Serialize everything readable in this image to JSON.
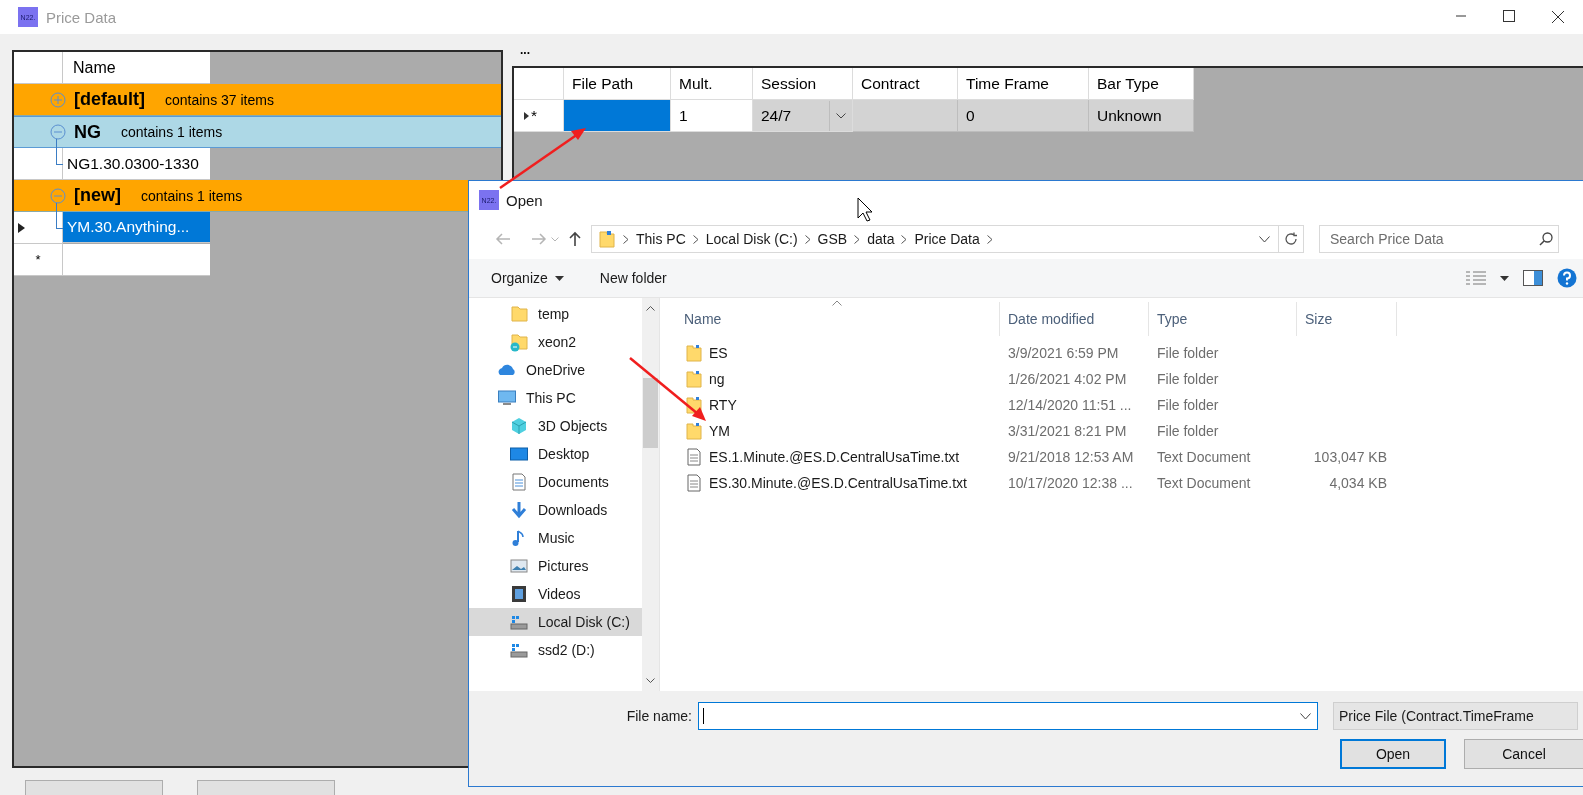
{
  "window": {
    "icon_label": "N22.",
    "title": "Price Data"
  },
  "groups_grid": {
    "column": "Name",
    "new_row_marker": "*",
    "groups": [
      {
        "name": "[default]",
        "summary": "contains 37 items",
        "expanded": false,
        "color": "#ffa500"
      },
      {
        "name": "NG",
        "summary": "contains 1 items",
        "expanded": true,
        "color": "#add8e6",
        "items": [
          {
            "name": "NG1.30.0300-1330",
            "selected": false,
            "current": false
          }
        ]
      },
      {
        "name": "[new]",
        "summary": "contains 1 items",
        "expanded": true,
        "color": "#ffa500",
        "items": [
          {
            "name": "YM.30.Anything...",
            "selected": true,
            "current": true
          }
        ]
      }
    ]
  },
  "details": {
    "label": "...",
    "columns": [
      "File Path",
      "Mult.",
      "Session",
      "Contract",
      "Time Frame",
      "Bar Type"
    ],
    "row": {
      "marker": "*",
      "current": true,
      "cells": [
        {
          "kind": "text",
          "selected": true
        },
        {
          "kind": "text",
          "value": "1",
          "selected": false
        },
        {
          "kind": "combo",
          "value": "24/7",
          "selected": false
        },
        {
          "kind": "locked",
          "selected": false
        },
        {
          "kind": "locked",
          "value": "0",
          "selected": false
        },
        {
          "kind": "locked",
          "value": "Unknown",
          "selected": false
        }
      ]
    }
  },
  "dialog": {
    "icon_label": "N22.",
    "title": "Open",
    "breadcrumb": [
      "This PC",
      "Local Disk (C:)",
      "GSB",
      "data",
      "Price Data"
    ],
    "search_placeholder": "Search Price Data",
    "toolbar": [
      {
        "label": "Organize",
        "dropdown": true
      },
      {
        "label": "New folder",
        "dropdown": false
      }
    ],
    "nav": [
      {
        "label": "temp",
        "kind": "folder",
        "selected": false
      },
      {
        "label": "xeon2",
        "kind": "synced-folder",
        "selected": false
      },
      {
        "label": "OneDrive",
        "kind": "cloud",
        "selected": false
      },
      {
        "label": "This PC",
        "kind": "computer",
        "selected": false,
        "children": [
          {
            "label": "3D Objects",
            "kind": "cube",
            "selected": false
          },
          {
            "label": "Desktop",
            "kind": "desktop",
            "selected": false
          },
          {
            "label": "Documents",
            "kind": "document",
            "selected": false
          },
          {
            "label": "Downloads",
            "kind": "download",
            "selected": false
          },
          {
            "label": "Music",
            "kind": "music",
            "selected": false
          },
          {
            "label": "Pictures",
            "kind": "picture",
            "selected": false
          },
          {
            "label": "Videos",
            "kind": "video",
            "selected": false
          },
          {
            "label": "Local Disk (C:)",
            "kind": "drive",
            "selected": true
          },
          {
            "label": "ssd2 (D:)",
            "kind": "drive",
            "selected": false
          }
        ]
      }
    ],
    "columns": [
      "Name",
      "Date modified",
      "Type",
      "Size"
    ],
    "files": [
      {
        "name": "ES",
        "date": "3/9/2021 6:59 PM",
        "type": "File folder",
        "kind": "folder"
      },
      {
        "name": "ng",
        "date": "1/26/2021 4:02 PM",
        "type": "File folder",
        "kind": "folder"
      },
      {
        "name": "RTY",
        "date": "12/14/2020 11:51 ...",
        "type": "File folder",
        "kind": "folder"
      },
      {
        "name": "YM",
        "date": "3/31/2021 8:21 PM",
        "type": "File folder",
        "kind": "folder"
      },
      {
        "name": "ES.1.Minute.@ES.D.CentralUsaTime.txt",
        "date": "9/21/2018 12:53 AM",
        "type": "Text Document",
        "size": "103,047 KB",
        "kind": "text"
      },
      {
        "name": "ES.30.Minute.@ES.D.CentralUsaTime.txt",
        "date": "10/17/2020 12:38 ...",
        "type": "Text Document",
        "size": "4,034 KB",
        "kind": "text"
      }
    ],
    "file_name_label": "File name:",
    "file_type": "Price File (Contract.TimeFrame",
    "buttons": [
      {
        "label": "Open",
        "default": true
      },
      {
        "label": "Cancel",
        "default": false
      }
    ]
  }
}
